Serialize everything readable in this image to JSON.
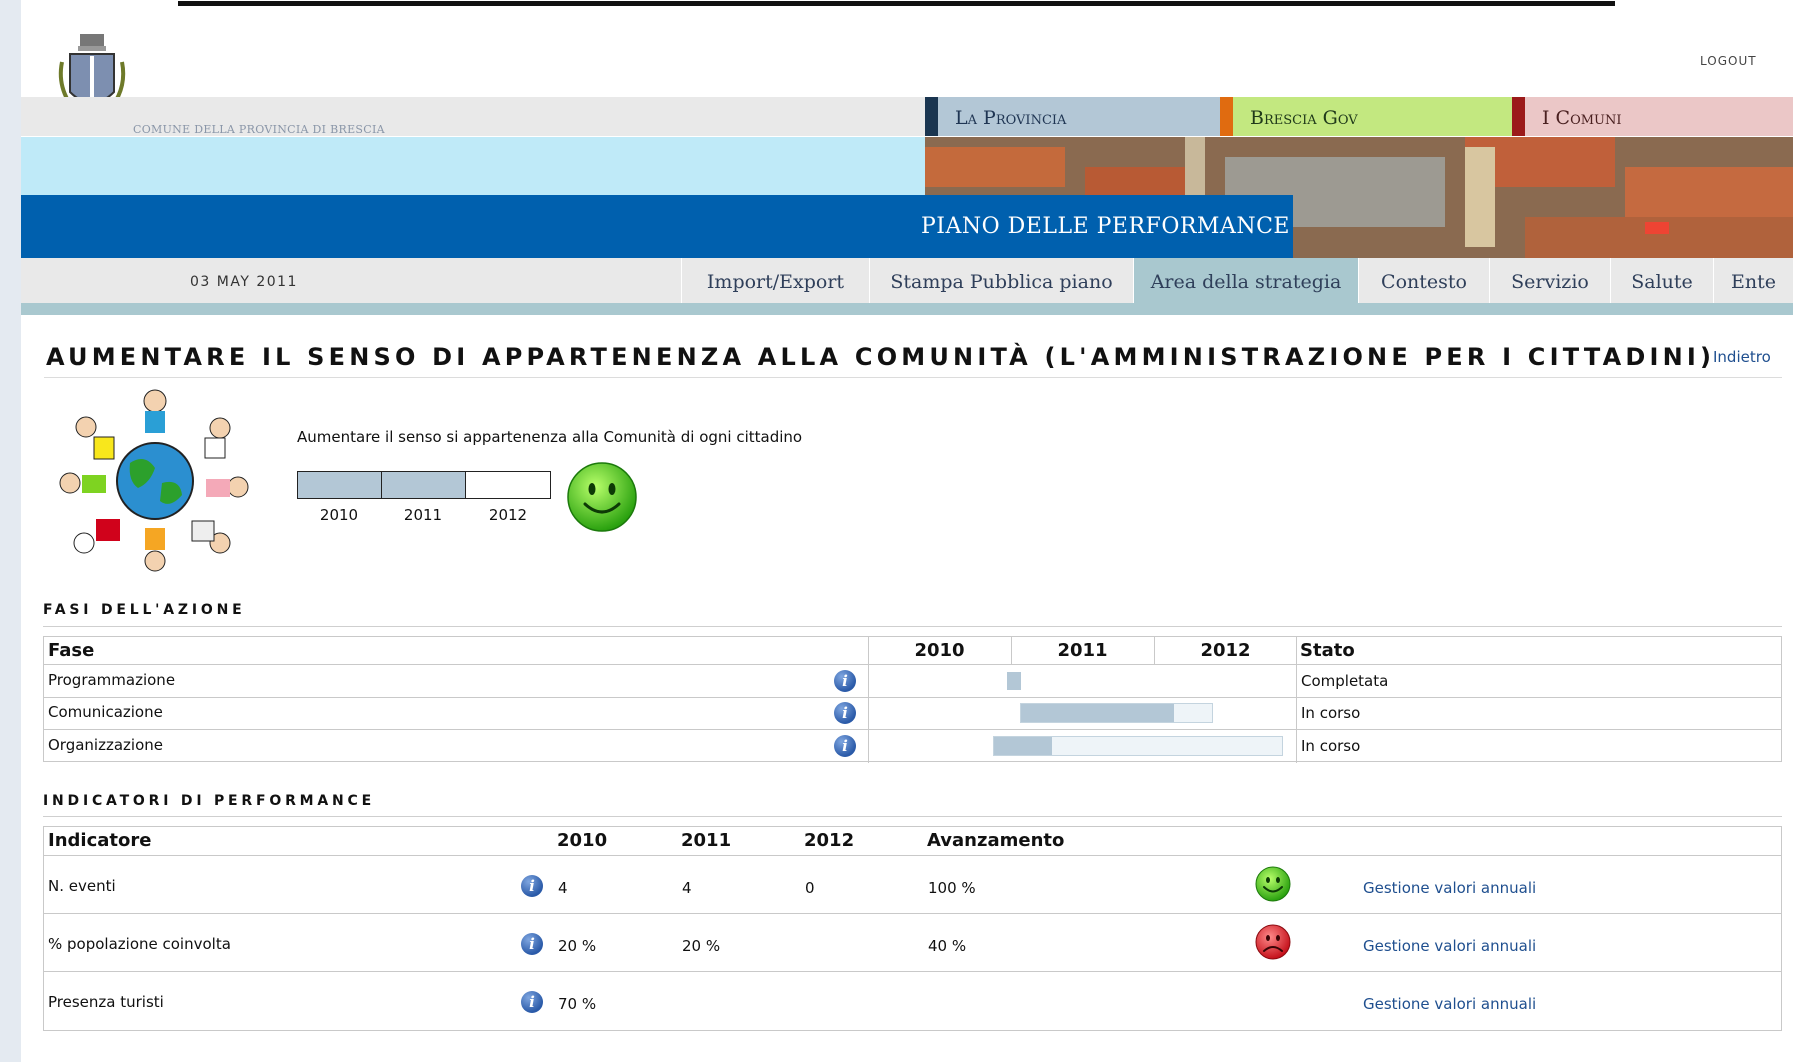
{
  "header": {
    "logout": "LOGOUT",
    "comune_label": "COMUNE DELLA PROVINCIA DI BRESCIA",
    "tabs": [
      {
        "label": "La Provincia",
        "color": "#b3c7d6",
        "accent": "#1a3550"
      },
      {
        "label": "Brescia Gov",
        "color": "#c3e880",
        "accent": "#e06b10"
      },
      {
        "label": "I Comuni",
        "color": "#ebc7c7",
        "accent": "#9b1a1a"
      }
    ],
    "banner_title": "PIANO DELLE PERFORMANCE"
  },
  "menu": {
    "date": "03 MAY 2011",
    "items": [
      {
        "label": "Import/Export",
        "active": false
      },
      {
        "label": "Stampa Pubblica piano",
        "active": false
      },
      {
        "label": "Area della strategia",
        "active": true
      },
      {
        "label": "Contesto",
        "active": false
      },
      {
        "label": "Servizio",
        "active": false
      },
      {
        "label": "Salute",
        "active": false
      },
      {
        "label": "Ente",
        "active": false
      }
    ]
  },
  "objective": {
    "title": "AUMENTARE IL SENSO DI APPARTENENZA ALLA COMUNITÀ (L'AMMINISTRAZIONE PER I CITTADINI)",
    "back_label": "Indietro",
    "description": "Aumentare il senso si appartenenza alla Comunità di ogni cittadino",
    "years": [
      "2010",
      "2011",
      "2012"
    ],
    "years_completed": 2,
    "status_icon": "happy-smiley-icon"
  },
  "phases": {
    "section_title": "FASI DELL'AZIONE",
    "headers": {
      "fase": "Fase",
      "y2010": "2010",
      "y2011": "2011",
      "y2012": "2012",
      "stato": "Stato"
    },
    "rows": [
      {
        "name": "Programmazione",
        "stato": "Completata",
        "start": 0.98,
        "end": 1.08,
        "progress": 1.0
      },
      {
        "name": "Comunicazione",
        "stato": "In corso",
        "start": 1.07,
        "end": 2.42,
        "progress": 0.8
      },
      {
        "name": "Organizzazione",
        "stato": "In corso",
        "start": 0.88,
        "end": 2.9,
        "progress": 0.2
      }
    ]
  },
  "indicators": {
    "section_title": "INDICATORI DI PERFORMANCE",
    "headers": {
      "indicatore": "Indicatore",
      "y2010": "2010",
      "y2011": "2011",
      "y2012": "2012",
      "avanzamento": "Avanzamento"
    },
    "rows": [
      {
        "name": "N. eventi",
        "v2010": "4",
        "v2011": "4",
        "v2012": "0",
        "avanzamento": "100 %",
        "status": "green",
        "link": "Gestione valori annuali"
      },
      {
        "name": "% popolazione coinvolta",
        "v2010": "20 %",
        "v2011": "20 %",
        "v2012": "",
        "avanzamento": "40 %",
        "status": "red",
        "link": "Gestione valori annuali"
      },
      {
        "name": "Presenza turisti",
        "v2010": "70 %",
        "v2011": "",
        "v2012": "",
        "avanzamento": "",
        "status": "none",
        "link": "Gestione valori annuali"
      }
    ]
  }
}
